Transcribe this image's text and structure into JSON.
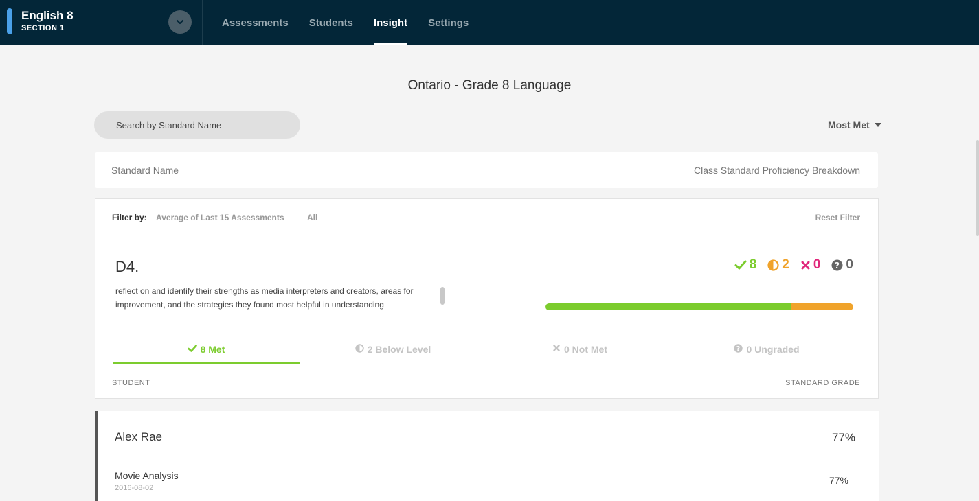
{
  "course": {
    "title": "English 8",
    "section": "SECTION 1"
  },
  "nav": {
    "items": [
      {
        "label": "Assessments",
        "active": false
      },
      {
        "label": "Students",
        "active": false
      },
      {
        "label": "Insight",
        "active": true
      },
      {
        "label": "Settings",
        "active": false
      }
    ]
  },
  "page": {
    "title": "Ontario - Grade 8 Language"
  },
  "search": {
    "placeholder": "Search by Standard Name"
  },
  "sort": {
    "label": "Most Met"
  },
  "table_header": {
    "left": "Standard Name",
    "right": "Class Standard Proficiency Breakdown"
  },
  "filter": {
    "label": "Filter by:",
    "option1": "Average of Last 15 Assessments",
    "option2": "All",
    "reset": "Reset Filter"
  },
  "standard": {
    "code": "D4.",
    "description": "reflect on and identify their strengths as media interpreters and creators, areas for improvement, and the strategies they found most helpful in understanding",
    "counts": {
      "met": "8",
      "below": "2",
      "not_met": "0",
      "ungraded": "0"
    },
    "met_count": 8,
    "below_count": 2,
    "not_met_count": 0,
    "ungraded_count": 0
  },
  "tabs": [
    {
      "label": "8 Met",
      "active": true
    },
    {
      "label": "2 Below Level",
      "active": false
    },
    {
      "label": "0 Not Met",
      "active": false
    },
    {
      "label": "0 Ungraded",
      "active": false
    }
  ],
  "columns": {
    "student": "STUDENT",
    "grade": "STANDARD GRADE"
  },
  "students": [
    {
      "name": "Alex Rae",
      "grade": "77%",
      "assessments": [
        {
          "name": "Movie Analysis",
          "date": "2016-08-02",
          "grade": "77%"
        }
      ]
    }
  ],
  "colors": {
    "topbar": "#032638",
    "met": "#7ccc2e",
    "below": "#f0a32b",
    "not_met": "#e0267a",
    "ungraded": "#666666"
  }
}
